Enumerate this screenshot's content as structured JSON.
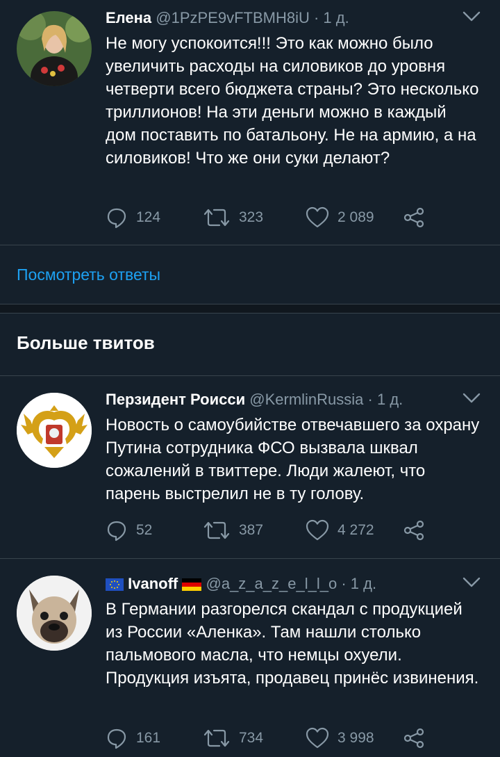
{
  "tweets": [
    {
      "name": "Елена",
      "handle": "@1PzPE9vFTBMH8iU",
      "time": "· 1 д.",
      "text": "Не могу успокоится!!! Это как можно было увеличить расходы на силовиков до уровня четверти всего бюджета страны? Это несколько триллионов! На эти деньги можно в каждый дом поставить по батальону. Не на армию, а на силовиков! Что же они суки делают?",
      "replies": "124",
      "retweets": "323",
      "likes": "2 089"
    },
    {
      "name": "Перзидент Роисси",
      "handle": "@KermlinRussia",
      "time": "· 1 д.",
      "text": "Новость о самоубийстве отвечавшего за охрану Путина сотрудника ФСО вызвала шквал сожалений в твиттере. Люди жалеют, что парень выстрелил не в ту голову.",
      "replies": "52",
      "retweets": "387",
      "likes": "4 272"
    },
    {
      "name": "Ivanoff",
      "handle": "@a_z_a_z_e_l_l_o",
      "time": "· 1 д.",
      "text": "В Германии разгорелся скандал с продукцией из России «Аленка». Там нашли столько пальмового масла, что немцы охуели. Продукция изъята, продавец принёс извинения.",
      "replies": "161",
      "retweets": "734",
      "likes": "3 998"
    }
  ],
  "view_replies": "Посмотреть ответы",
  "section_title": "Больше твитов",
  "icons": {
    "reply": "reply-icon",
    "retweet": "retweet-icon",
    "like": "heart-icon",
    "share": "share-icon",
    "more": "chevron-down-icon"
  },
  "colors": {
    "background": "#15202b",
    "accent": "#1da1f2",
    "secondary_text": "#8899a6",
    "divider": "#38444d"
  }
}
